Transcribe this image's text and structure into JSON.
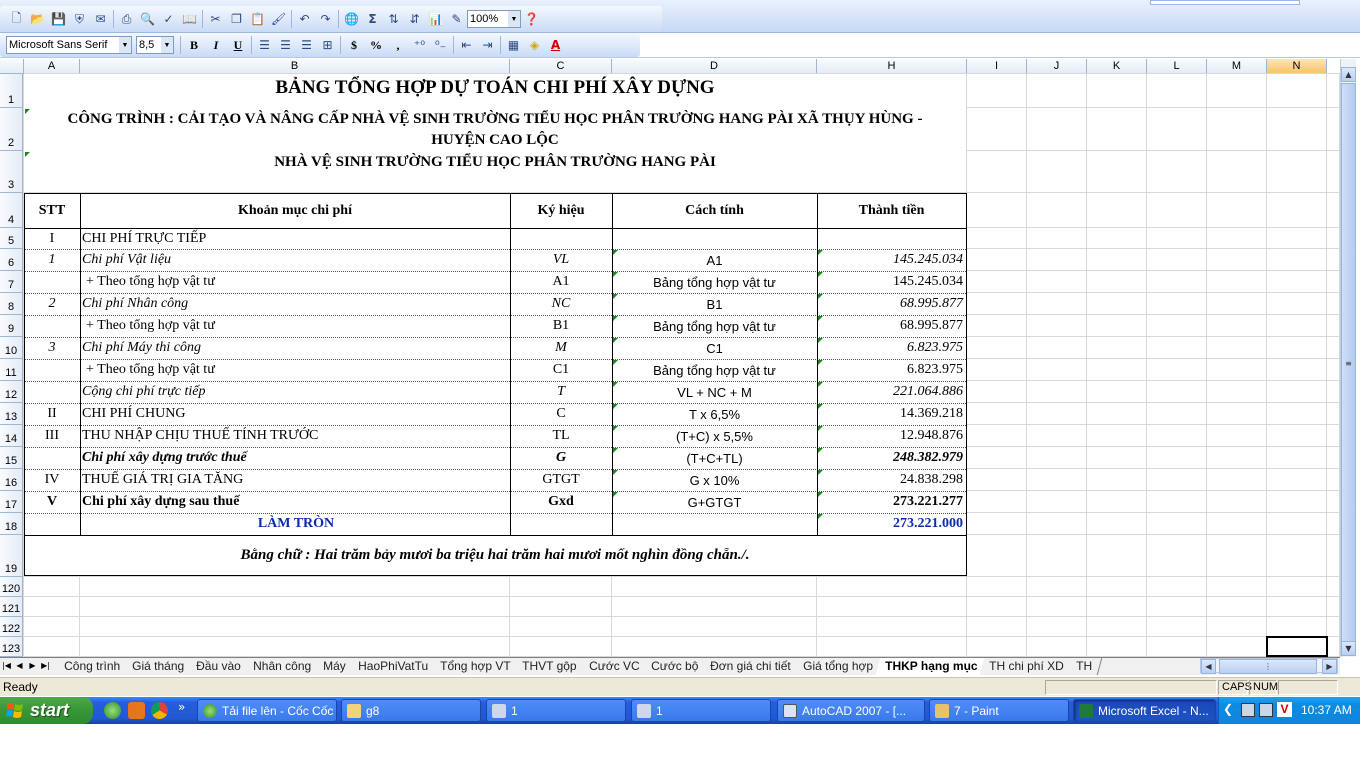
{
  "toolbar": {
    "zoom": "100%",
    "font_name": "Microsoft Sans Serif",
    "font_size": "8,5",
    "bold": "B",
    "italic": "I",
    "underline": "U",
    "currency": "$",
    "percent": "%",
    "comma": ",",
    "sigma": "Σ"
  },
  "columns": [
    "A",
    "B",
    "C",
    "D",
    "H",
    "I",
    "J",
    "K",
    "L",
    "M",
    "N"
  ],
  "rows": [
    "1",
    "2",
    "3",
    "4",
    "5",
    "6",
    "7",
    "8",
    "9",
    "10",
    "11",
    "12",
    "13",
    "14",
    "15",
    "16",
    "17",
    "18",
    "19",
    "120",
    "121",
    "122",
    "123"
  ],
  "sheet": {
    "title": "BẢNG TỔNG HỢP DỰ TOÁN CHI PHÍ XÂY DỰNG",
    "project_line1": "CÔNG TRÌNH : CẢI TẠO VÀ NÂNG CẤP NHÀ VỆ SINH TRƯỜNG TIỂU HỌC PHÂN TRƯỜNG HANG PÀI XÃ THỤY HÙNG -",
    "project_line2": "HUYỆN CAO LỘC",
    "subtitle": "NHÀ VỆ SINH TRƯỜNG TIỂU HỌC PHÂN TRƯỜNG HANG PÀI",
    "headers": {
      "stt": "STT",
      "item": "Khoản mục chi phí",
      "symbol": "Ký hiệu",
      "formula": "Cách tính",
      "amount": "Thành tiền"
    },
    "table": [
      {
        "stt": "I",
        "item": "CHI PHÍ TRỰC TIẾP",
        "symbol": "",
        "formula": "",
        "amount": ""
      },
      {
        "stt": "1",
        "item": "Chi phí Vật liệu",
        "symbol": "VL",
        "formula": "A1",
        "amount": "145.245.034"
      },
      {
        "stt": "",
        "item": "+ Theo tổng hợp vật tư",
        "symbol": "A1",
        "formula": "Bảng tổng hợp vật tư",
        "amount": "145.245.034"
      },
      {
        "stt": "2",
        "item": "Chi phí Nhân công",
        "symbol": "NC",
        "formula": "B1",
        "amount": "68.995.877"
      },
      {
        "stt": "",
        "item": "+ Theo tổng hợp vật tư",
        "symbol": "B1",
        "formula": "Bảng tổng hợp vật tư",
        "amount": "68.995.877"
      },
      {
        "stt": "3",
        "item": "Chi phí Máy thi công",
        "symbol": "M",
        "formula": "C1",
        "amount": "6.823.975"
      },
      {
        "stt": "",
        "item": "+ Theo tổng hợp vật tư",
        "symbol": "C1",
        "formula": "Bảng tổng hợp vật tư",
        "amount": "6.823.975"
      },
      {
        "stt": "",
        "item": "Cộng chi phí trực tiếp",
        "symbol": "T",
        "formula": "VL + NC + M",
        "amount": "221.064.886"
      },
      {
        "stt": "II",
        "item": "CHI PHÍ CHUNG",
        "symbol": "C",
        "formula": "T x 6,5%",
        "amount": "14.369.218"
      },
      {
        "stt": "III",
        "item": "THU NHẬP CHỊU THUẾ TÍNH TRƯỚC",
        "symbol": "TL",
        "formula": "(T+C) x 5,5%",
        "amount": "12.948.876"
      },
      {
        "stt": "",
        "item": "Chi phí xây dựng trước thuế",
        "symbol": "G",
        "formula": "(T+C+TL)",
        "amount": "248.382.979"
      },
      {
        "stt": "IV",
        "item": "THUẾ GIÁ TRỊ GIA TĂNG",
        "symbol": "GTGT",
        "formula": "G x 10%",
        "amount": "24.838.298"
      },
      {
        "stt": "V",
        "item": "Chi phí xây dựng sau thuế",
        "symbol": "Gxd",
        "formula": "G+GTGT",
        "amount": "273.221.277"
      },
      {
        "stt": "",
        "item": "LÀM TRÒN",
        "symbol": "",
        "formula": "",
        "amount": "273.221.000"
      }
    ],
    "in_words": "Bằng chữ : Hai trăm bảy mươi ba triệu hai trăm hai mươi mốt nghìn đồng chẵn./."
  },
  "tabs": [
    "Công trình",
    "Giá tháng",
    "Đầu vào",
    "Nhân công",
    "Máy",
    "HaoPhiVatTu",
    "Tổng hợp VT",
    "THVT gộp",
    "Cước VC",
    "Cước bộ",
    "Đơn giá chi tiết",
    "Giá tổng hợp",
    "THKP hạng mục",
    "TH chi phí XD",
    "TH"
  ],
  "active_tab": "THKP hạng mục",
  "status": {
    "text": "Ready",
    "caps": "CAPS",
    "num": "NUM"
  },
  "taskbar": {
    "start": "start",
    "tasks": [
      "Tải file lên - Cốc Cốc",
      "g8",
      "1",
      "1",
      "AutoCAD 2007 - [...",
      "7 - Paint",
      "Microsoft Excel - N..."
    ],
    "clock": "10:37 AM"
  },
  "colors": {
    "accent_blue": "#0a2bb0",
    "taskbar": "#245edb",
    "start_green": "#3c9a3a"
  }
}
